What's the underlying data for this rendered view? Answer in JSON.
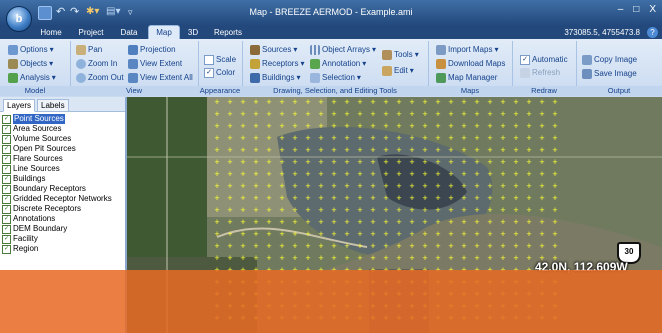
{
  "window": {
    "title": "Map - BREEZE AERMOD - Example.ami",
    "controls": [
      "–",
      "□",
      "X"
    ],
    "orb_label": "b"
  },
  "tabs": [
    "Home",
    "Project",
    "Data",
    "Map",
    "3D",
    "Reports"
  ],
  "active_tab": "Map",
  "coordinates_readout": "373085.5, 4755473.8",
  "ribbon": {
    "model": {
      "label": "Model",
      "items": [
        "Options",
        "Objects",
        "Analysis"
      ]
    },
    "view": {
      "label": "View",
      "items": [
        "Pan",
        "Zoom In",
        "Zoom Out",
        "Projection",
        "View Extent",
        "View Extent All"
      ]
    },
    "appearance": {
      "label": "Appearance",
      "items": [
        "Scale",
        "Color"
      ],
      "scale_checked": false,
      "color_checked": true
    },
    "drawing": {
      "label": "Drawing, Selection, and Editing Tools",
      "items": [
        "Sources",
        "Receptors",
        "Buildings",
        "Object Arrays",
        "Annotation",
        "Selection",
        "Tools",
        "Edit"
      ]
    },
    "maps": {
      "label": "Maps",
      "items": [
        "Import Maps",
        "Download Maps",
        "Map Manager"
      ]
    },
    "redraw": {
      "label": "Redraw",
      "items": [
        "Automatic",
        "Refresh"
      ],
      "automatic_checked": true
    },
    "output": {
      "label": "Output",
      "items": [
        "Copy Image",
        "Save Image"
      ]
    }
  },
  "panel": {
    "tabs": [
      "Layers",
      "Labels"
    ],
    "active_tab": "Layers",
    "layers": [
      {
        "label": "Point Sources",
        "checked": true,
        "selected": true
      },
      {
        "label": "Area Sources",
        "checked": true
      },
      {
        "label": "Volume Sources",
        "checked": true
      },
      {
        "label": "Open Pit Sources",
        "checked": true
      },
      {
        "label": "Flare Sources",
        "checked": true
      },
      {
        "label": "Line Sources",
        "checked": true
      },
      {
        "label": "Buildings",
        "checked": true
      },
      {
        "label": "Boundary Receptors",
        "checked": true
      },
      {
        "label": "Gridded Receptor Networks",
        "checked": true
      },
      {
        "label": "Discrete Receptors",
        "checked": true
      },
      {
        "label": "Annotations",
        "checked": true
      },
      {
        "label": "DEM Boundary",
        "checked": true
      },
      {
        "label": "Facility",
        "checked": true
      },
      {
        "label": "Region",
        "checked": true
      }
    ]
  },
  "map": {
    "latlon_label": "42.0N, 112.609W",
    "route_shield": "30",
    "receptor_color": "#ffff33"
  },
  "colors": {
    "title_bar": "#2b548a",
    "ribbon": "#dbe7f6",
    "selection": "#3166c4",
    "overlay": "#e86a24"
  }
}
